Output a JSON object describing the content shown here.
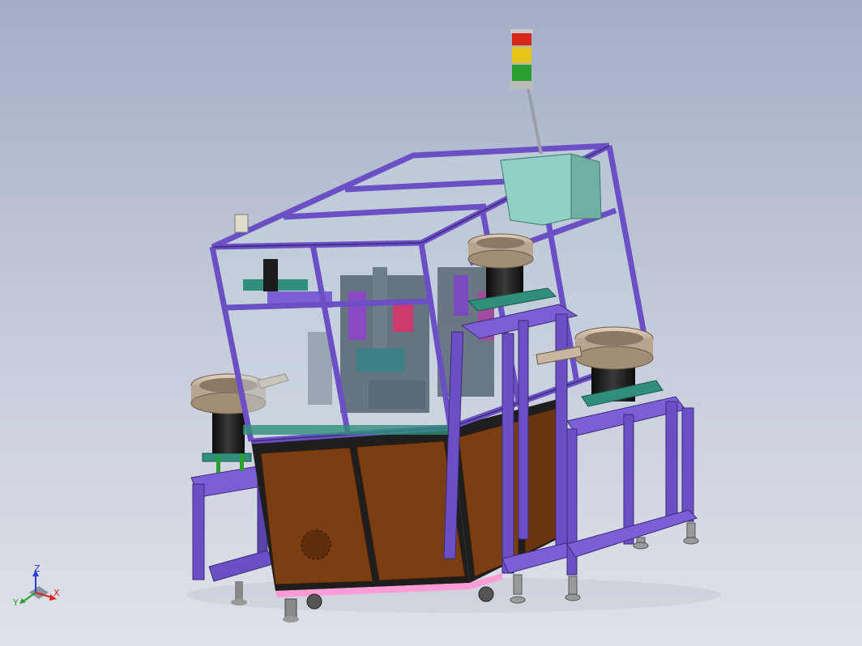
{
  "viewport": {
    "background_top": "#a3aec6",
    "background_bottom": "#dfe2e8"
  },
  "model": {
    "frame_color": "#6b4fc4",
    "frame_edge_color": "#3c2a7a",
    "cabinet_color": "#7a3e12",
    "cabinet_frame_color": "#1e1e1e",
    "glass_color": "#c9d6e0",
    "bowl_rim_color": "#c8b6a0",
    "bowl_body_color": "#1c1c1c",
    "plate_color": "#2f8f7a",
    "panel_box_color": "#8fd1c4"
  },
  "signal_tower": {
    "lights": [
      "red",
      "yellow",
      "green"
    ],
    "colors": [
      "#d9261c",
      "#e8c51a",
      "#2aa12e"
    ]
  },
  "triad": {
    "z": "Z",
    "y": "Y",
    "x": "X",
    "z_color": "#2a3bd0",
    "y_color": "#2aa12e",
    "x_color": "#d9261c"
  }
}
